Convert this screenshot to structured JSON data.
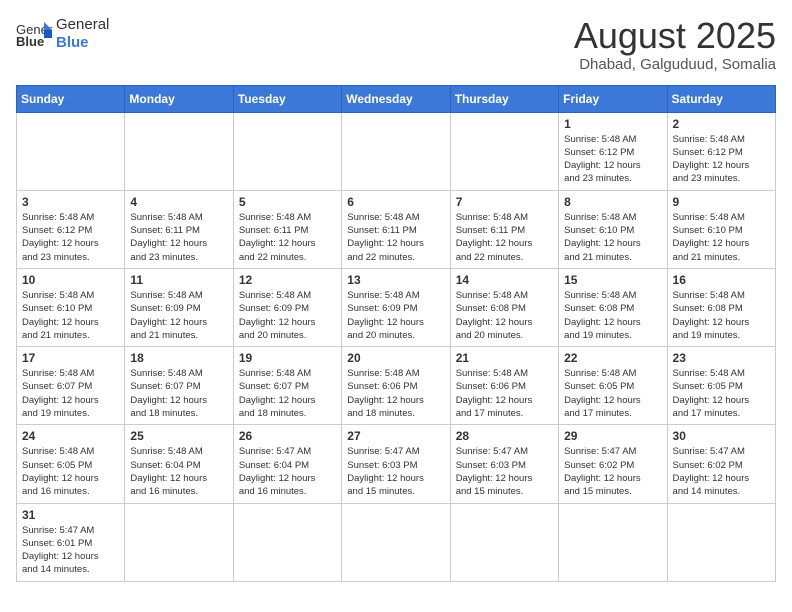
{
  "logo": {
    "text_normal": "General",
    "text_bold": "Blue"
  },
  "title": "August 2025",
  "subtitle": "Dhabad, Galguduud, Somalia",
  "days_header": [
    "Sunday",
    "Monday",
    "Tuesday",
    "Wednesday",
    "Thursday",
    "Friday",
    "Saturday"
  ],
  "weeks": [
    [
      {
        "day": "",
        "info": ""
      },
      {
        "day": "",
        "info": ""
      },
      {
        "day": "",
        "info": ""
      },
      {
        "day": "",
        "info": ""
      },
      {
        "day": "",
        "info": ""
      },
      {
        "day": "1",
        "info": "Sunrise: 5:48 AM\nSunset: 6:12 PM\nDaylight: 12 hours\nand 23 minutes."
      },
      {
        "day": "2",
        "info": "Sunrise: 5:48 AM\nSunset: 6:12 PM\nDaylight: 12 hours\nand 23 minutes."
      }
    ],
    [
      {
        "day": "3",
        "info": "Sunrise: 5:48 AM\nSunset: 6:12 PM\nDaylight: 12 hours\nand 23 minutes."
      },
      {
        "day": "4",
        "info": "Sunrise: 5:48 AM\nSunset: 6:11 PM\nDaylight: 12 hours\nand 23 minutes."
      },
      {
        "day": "5",
        "info": "Sunrise: 5:48 AM\nSunset: 6:11 PM\nDaylight: 12 hours\nand 22 minutes."
      },
      {
        "day": "6",
        "info": "Sunrise: 5:48 AM\nSunset: 6:11 PM\nDaylight: 12 hours\nand 22 minutes."
      },
      {
        "day": "7",
        "info": "Sunrise: 5:48 AM\nSunset: 6:11 PM\nDaylight: 12 hours\nand 22 minutes."
      },
      {
        "day": "8",
        "info": "Sunrise: 5:48 AM\nSunset: 6:10 PM\nDaylight: 12 hours\nand 21 minutes."
      },
      {
        "day": "9",
        "info": "Sunrise: 5:48 AM\nSunset: 6:10 PM\nDaylight: 12 hours\nand 21 minutes."
      }
    ],
    [
      {
        "day": "10",
        "info": "Sunrise: 5:48 AM\nSunset: 6:10 PM\nDaylight: 12 hours\nand 21 minutes."
      },
      {
        "day": "11",
        "info": "Sunrise: 5:48 AM\nSunset: 6:09 PM\nDaylight: 12 hours\nand 21 minutes."
      },
      {
        "day": "12",
        "info": "Sunrise: 5:48 AM\nSunset: 6:09 PM\nDaylight: 12 hours\nand 20 minutes."
      },
      {
        "day": "13",
        "info": "Sunrise: 5:48 AM\nSunset: 6:09 PM\nDaylight: 12 hours\nand 20 minutes."
      },
      {
        "day": "14",
        "info": "Sunrise: 5:48 AM\nSunset: 6:08 PM\nDaylight: 12 hours\nand 20 minutes."
      },
      {
        "day": "15",
        "info": "Sunrise: 5:48 AM\nSunset: 6:08 PM\nDaylight: 12 hours\nand 19 minutes."
      },
      {
        "day": "16",
        "info": "Sunrise: 5:48 AM\nSunset: 6:08 PM\nDaylight: 12 hours\nand 19 minutes."
      }
    ],
    [
      {
        "day": "17",
        "info": "Sunrise: 5:48 AM\nSunset: 6:07 PM\nDaylight: 12 hours\nand 19 minutes."
      },
      {
        "day": "18",
        "info": "Sunrise: 5:48 AM\nSunset: 6:07 PM\nDaylight: 12 hours\nand 18 minutes."
      },
      {
        "day": "19",
        "info": "Sunrise: 5:48 AM\nSunset: 6:07 PM\nDaylight: 12 hours\nand 18 minutes."
      },
      {
        "day": "20",
        "info": "Sunrise: 5:48 AM\nSunset: 6:06 PM\nDaylight: 12 hours\nand 18 minutes."
      },
      {
        "day": "21",
        "info": "Sunrise: 5:48 AM\nSunset: 6:06 PM\nDaylight: 12 hours\nand 17 minutes."
      },
      {
        "day": "22",
        "info": "Sunrise: 5:48 AM\nSunset: 6:05 PM\nDaylight: 12 hours\nand 17 minutes."
      },
      {
        "day": "23",
        "info": "Sunrise: 5:48 AM\nSunset: 6:05 PM\nDaylight: 12 hours\nand 17 minutes."
      }
    ],
    [
      {
        "day": "24",
        "info": "Sunrise: 5:48 AM\nSunset: 6:05 PM\nDaylight: 12 hours\nand 16 minutes."
      },
      {
        "day": "25",
        "info": "Sunrise: 5:48 AM\nSunset: 6:04 PM\nDaylight: 12 hours\nand 16 minutes."
      },
      {
        "day": "26",
        "info": "Sunrise: 5:47 AM\nSunset: 6:04 PM\nDaylight: 12 hours\nand 16 minutes."
      },
      {
        "day": "27",
        "info": "Sunrise: 5:47 AM\nSunset: 6:03 PM\nDaylight: 12 hours\nand 15 minutes."
      },
      {
        "day": "28",
        "info": "Sunrise: 5:47 AM\nSunset: 6:03 PM\nDaylight: 12 hours\nand 15 minutes."
      },
      {
        "day": "29",
        "info": "Sunrise: 5:47 AM\nSunset: 6:02 PM\nDaylight: 12 hours\nand 15 minutes."
      },
      {
        "day": "30",
        "info": "Sunrise: 5:47 AM\nSunset: 6:02 PM\nDaylight: 12 hours\nand 14 minutes."
      }
    ],
    [
      {
        "day": "31",
        "info": "Sunrise: 5:47 AM\nSunset: 6:01 PM\nDaylight: 12 hours\nand 14 minutes."
      },
      {
        "day": "",
        "info": ""
      },
      {
        "day": "",
        "info": ""
      },
      {
        "day": "",
        "info": ""
      },
      {
        "day": "",
        "info": ""
      },
      {
        "day": "",
        "info": ""
      },
      {
        "day": "",
        "info": ""
      }
    ]
  ]
}
